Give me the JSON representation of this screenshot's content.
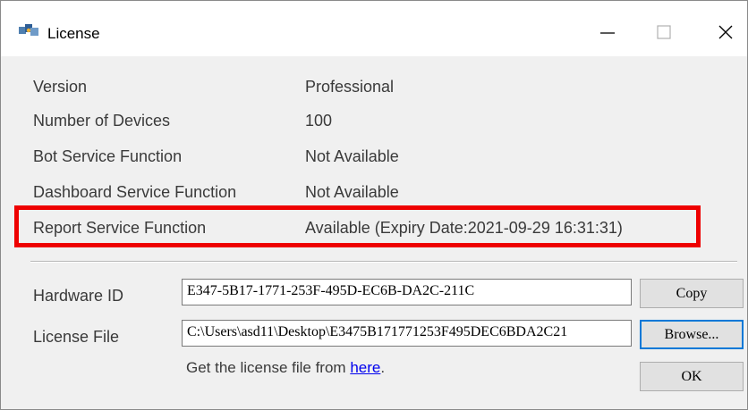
{
  "window": {
    "title": "License",
    "icon": "license-app-icon"
  },
  "title_controls": {
    "minimize": "minimize-icon",
    "maximize": "maximize-icon",
    "close": "close-icon"
  },
  "info_rows": [
    {
      "label": "Version",
      "value": "Professional"
    },
    {
      "label": "Number of Devices",
      "value": "100"
    },
    {
      "label": "Bot Service Function",
      "value": "Not Available"
    },
    {
      "label": "Dashboard Service Function",
      "value": "Not Available"
    },
    {
      "label": "Report Service Function",
      "value": "Available (Expiry Date:2021-09-29 16:31:31)"
    }
  ],
  "highlight_color": "#ee0000",
  "hardware_id": {
    "label": "Hardware ID",
    "value": "E347-5B17-1771-253F-495D-EC6B-DA2C-211C",
    "button": "Copy"
  },
  "license_file": {
    "label": "License File",
    "value": "C:\\Users\\asd11\\Desktop\\E3475B171771253F495DEC6BDA2C21",
    "button": "Browse..."
  },
  "hint": {
    "text": "Get the license file from ",
    "link": "here",
    "suffix": "."
  },
  "ok_button": "OK"
}
